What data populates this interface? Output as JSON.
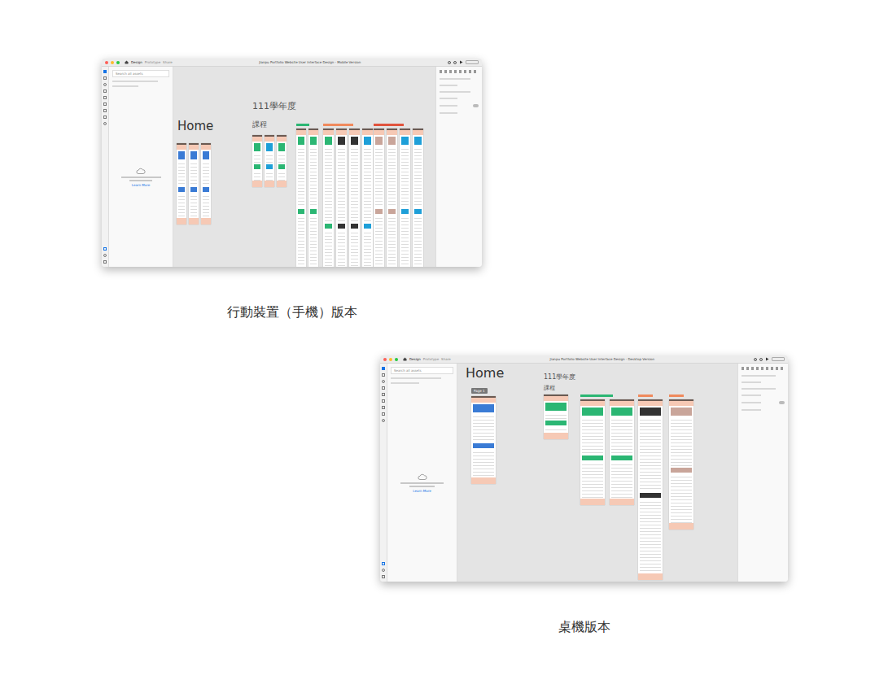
{
  "windows": [
    {
      "title": "Jianpu Portfolio Website User Interface Design - Mobile Version",
      "tabs": [
        {
          "label": "Design",
          "selected": true
        },
        {
          "label": "Prototype",
          "selected": false
        },
        {
          "label": "Share",
          "selected": false
        }
      ],
      "search": {
        "placeholder": "Search all assets"
      },
      "panel_link": "Learn More",
      "home": "Home",
      "year": "111學年度",
      "course": "課程",
      "groups": [
        {
          "accent": "",
          "boards": [
            {
              "color": "#3a7bd5"
            },
            {
              "color": "#3a7bd5"
            },
            {
              "color": "#3a7bd5"
            }
          ]
        },
        {
          "accent": "",
          "boards": [
            {
              "color": "#2bb673"
            },
            {
              "color": "#1e9fd8"
            },
            {
              "color": "#2bb673"
            }
          ]
        },
        {
          "accent": "#2bb673",
          "boards": [
            {
              "color": "#2bb673"
            },
            {
              "color": "#2bb673"
            }
          ]
        },
        {
          "accent": "#f08a5d",
          "boards": [
            {
              "color": "#2bb673"
            },
            {
              "color": "#333333"
            },
            {
              "color": "#333333"
            },
            {
              "color": "#1e9fd8"
            }
          ]
        },
        {
          "accent": "#e0533d",
          "boards": [
            {
              "color": "#c9a59a"
            },
            {
              "color": "#c9a59a"
            },
            {
              "color": "#1e9fd8"
            },
            {
              "color": "#1e9fd8"
            }
          ]
        }
      ],
      "caption": "行動裝置（手機）版本"
    },
    {
      "title": "Jianpu Portfolio Website User Interface Design - Desktop Version",
      "tabs": [
        {
          "label": "Design",
          "selected": true
        },
        {
          "label": "Prototype",
          "selected": false
        },
        {
          "label": "Share",
          "selected": false
        }
      ],
      "search": {
        "placeholder": "Search all assets"
      },
      "panel_link": "Learn More",
      "home": "Home",
      "year": "111學年度",
      "course": "課程",
      "page_tag": "Page 1",
      "groups": [
        {
          "accent": "",
          "boards": [
            {
              "color": "#3a7bd5"
            }
          ]
        },
        {
          "accent": "",
          "boards": [
            {
              "color": "#2bb673"
            }
          ]
        },
        {
          "accent": "#2bb673",
          "boards": [
            {
              "color": "#2bb673"
            },
            {
              "color": "#2bb673"
            }
          ]
        },
        {
          "accent": "#f08a5d",
          "boards": [
            {
              "color": "#333333"
            }
          ]
        },
        {
          "accent": "#f08a5d",
          "boards": [
            {
              "color": "#c9a59a"
            }
          ]
        }
      ],
      "caption": "桌機版本"
    }
  ]
}
